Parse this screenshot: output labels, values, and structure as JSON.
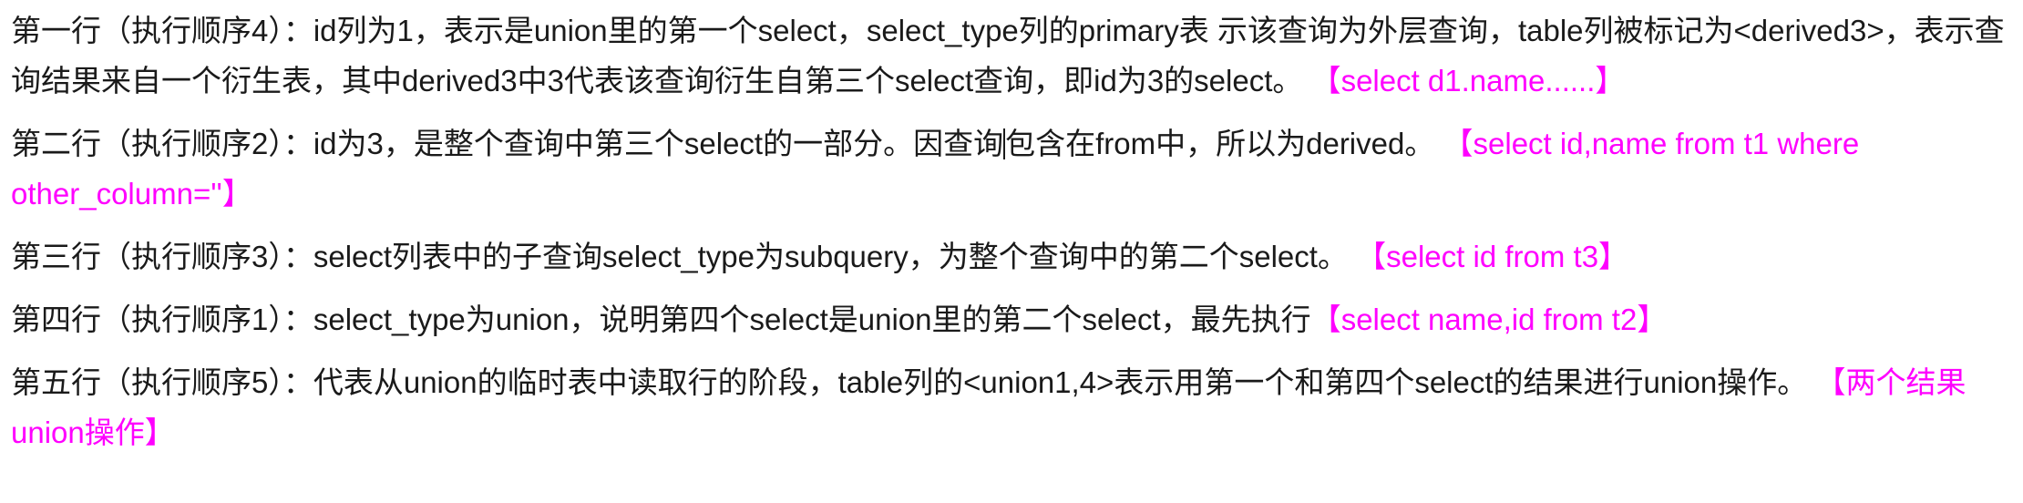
{
  "paragraphs": [
    {
      "text": "第一行（执行顺序4）：id列为1，表示是union里的第一个select，select_type列的primary表 示该查询为外层查询，table列被标记为<derived3>，表示查询结果来自一个衍生表，其中derived3中3代表该查询衍生自第三个select查询，即id为3的select。",
      "highlight": "【select d1.name......】"
    },
    {
      "text_before_cursor": "第二行（执行顺序2）：id为3，是整个查询中第三个select的一部分。因查询",
      "text_after_cursor": "包含在from中，所以为derived。",
      "highlight": "【select id,name from t1 where other_column=''】"
    },
    {
      "text": "第三行（执行顺序3）：select列表中的子查询select_type为subquery，为整个查询中的第二个select。",
      "highlight": "【select id from t3】"
    },
    {
      "text": "第四行（执行顺序1）：select_type为union，说明第四个select是union里的第二个select，最先执行",
      "highlight": "【select name,id from t2】"
    },
    {
      "text": "第五行（执行顺序5）：代表从union的临时表中读取行的阶段，table列的<union1,4>表示用第一个和第四个select的结果进行union操作。",
      "highlight": "【两个结果union操作】"
    }
  ],
  "colors": {
    "body_text": "#1a1a1a",
    "highlight": "#ff00ff",
    "background": "#ffffff"
  }
}
